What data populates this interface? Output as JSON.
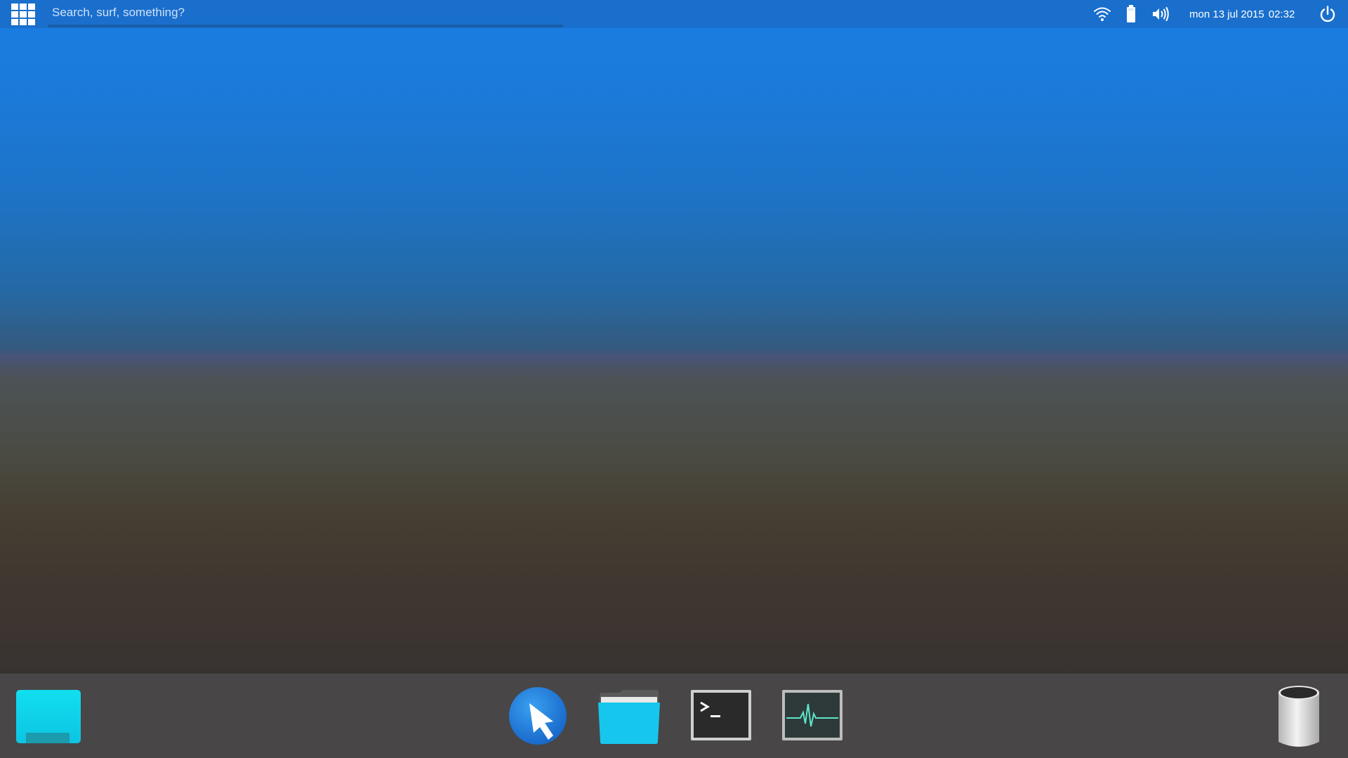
{
  "top_panel": {
    "search": {
      "placeholder": "Search, surf, something?",
      "value": ""
    },
    "tray": {
      "icons": [
        "wifi-icon",
        "battery-icon",
        "volume-icon",
        "power-icon"
      ]
    },
    "clock": {
      "date": "mon 13 jul 2015",
      "time": "02:32"
    }
  },
  "dock": {
    "left": [
      "show-desktop"
    ],
    "center": [
      "cursor-app",
      "file-manager",
      "terminal",
      "system-monitor"
    ],
    "right": [
      "trash"
    ]
  },
  "colors": {
    "panel": "#1a6fcd",
    "dock": "#484646",
    "accent": "#11d0e8"
  }
}
